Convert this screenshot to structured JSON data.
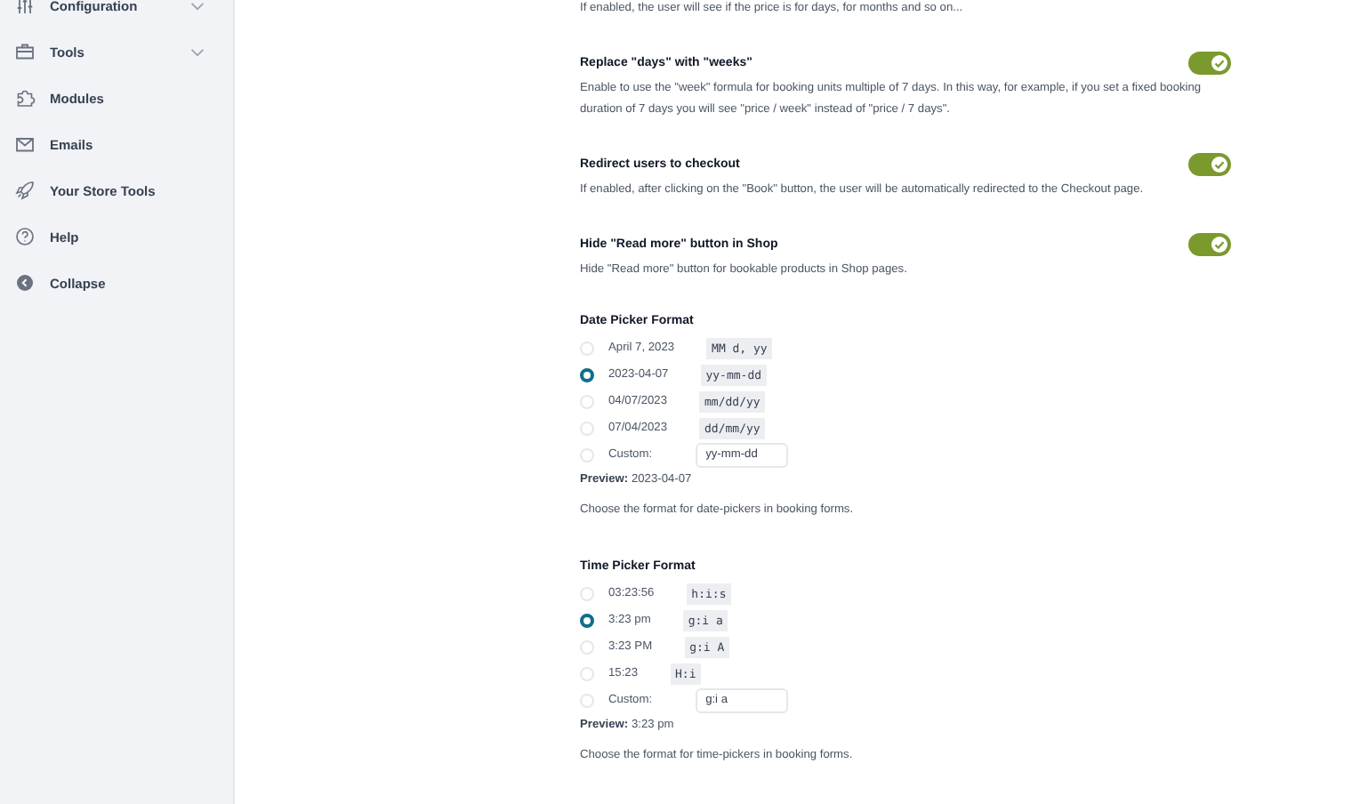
{
  "sidebar": {
    "items": [
      {
        "label": "Configuration",
        "has_caret": true
      },
      {
        "label": "Tools",
        "has_caret": true
      },
      {
        "label": "Modules",
        "has_caret": false
      },
      {
        "label": "Emails",
        "has_caret": false
      },
      {
        "label": "Your Store Tools",
        "has_caret": false
      },
      {
        "label": "Help",
        "has_caret": false
      },
      {
        "label": "Collapse",
        "has_caret": false
      }
    ]
  },
  "top_description": "If enabled, the user will see if the price is for days, for months and so on...",
  "settings": [
    {
      "title": "Replace \"days\" with \"weeks\"",
      "on": true,
      "description": "Enable to use the \"week\" formula for booking units multiple of 7 days. In this way, for example, if you set a fixed booking duration of 7 days you will see \"price / week\" instead of \"price / 7 days\"."
    },
    {
      "title": "Redirect users to checkout",
      "on": true,
      "description": "If enabled, after clicking on the \"Book\" button, the user will be automatically redirected to the Checkout page."
    },
    {
      "title": "Hide \"Read more\" button in Shop",
      "on": true,
      "description": "Hide \"Read more\" button for bookable products in Shop pages."
    }
  ],
  "pickers": [
    {
      "title": "Date Picker Format",
      "options": [
        {
          "kind": "preset",
          "label": "April 7, 2023",
          "code": "MM d, yy",
          "selected": false
        },
        {
          "kind": "preset",
          "label": "2023-04-07",
          "code": "yy-mm-dd",
          "selected": true
        },
        {
          "kind": "preset",
          "label": "04/07/2023",
          "code": "mm/dd/yy",
          "selected": false
        },
        {
          "kind": "preset",
          "label": "07/04/2023",
          "code": "dd/mm/yy",
          "selected": false
        },
        {
          "kind": "custom",
          "label": "Custom:",
          "value": "yy-mm-dd",
          "selected": false
        }
      ],
      "preview_label": "Preview:",
      "preview": "2023-04-07",
      "help": "Choose the format for date-pickers in booking forms."
    },
    {
      "title": "Time Picker Format",
      "options": [
        {
          "kind": "preset",
          "label": "03:23:56",
          "code": "h:i:s",
          "selected": false
        },
        {
          "kind": "preset",
          "label": "3:23 pm",
          "code": "g:i a",
          "selected": true
        },
        {
          "kind": "preset",
          "label": "3:23 PM",
          "code": "g:i A",
          "selected": false
        },
        {
          "kind": "preset",
          "label": "15:23",
          "code": "H:i",
          "selected": false
        },
        {
          "kind": "custom",
          "label": "Custom:",
          "value": "g:i a",
          "selected": false
        }
      ],
      "preview_label": "Preview:",
      "preview": "3:23 pm",
      "help": "Choose the format for time-pickers in booking forms."
    }
  ]
}
